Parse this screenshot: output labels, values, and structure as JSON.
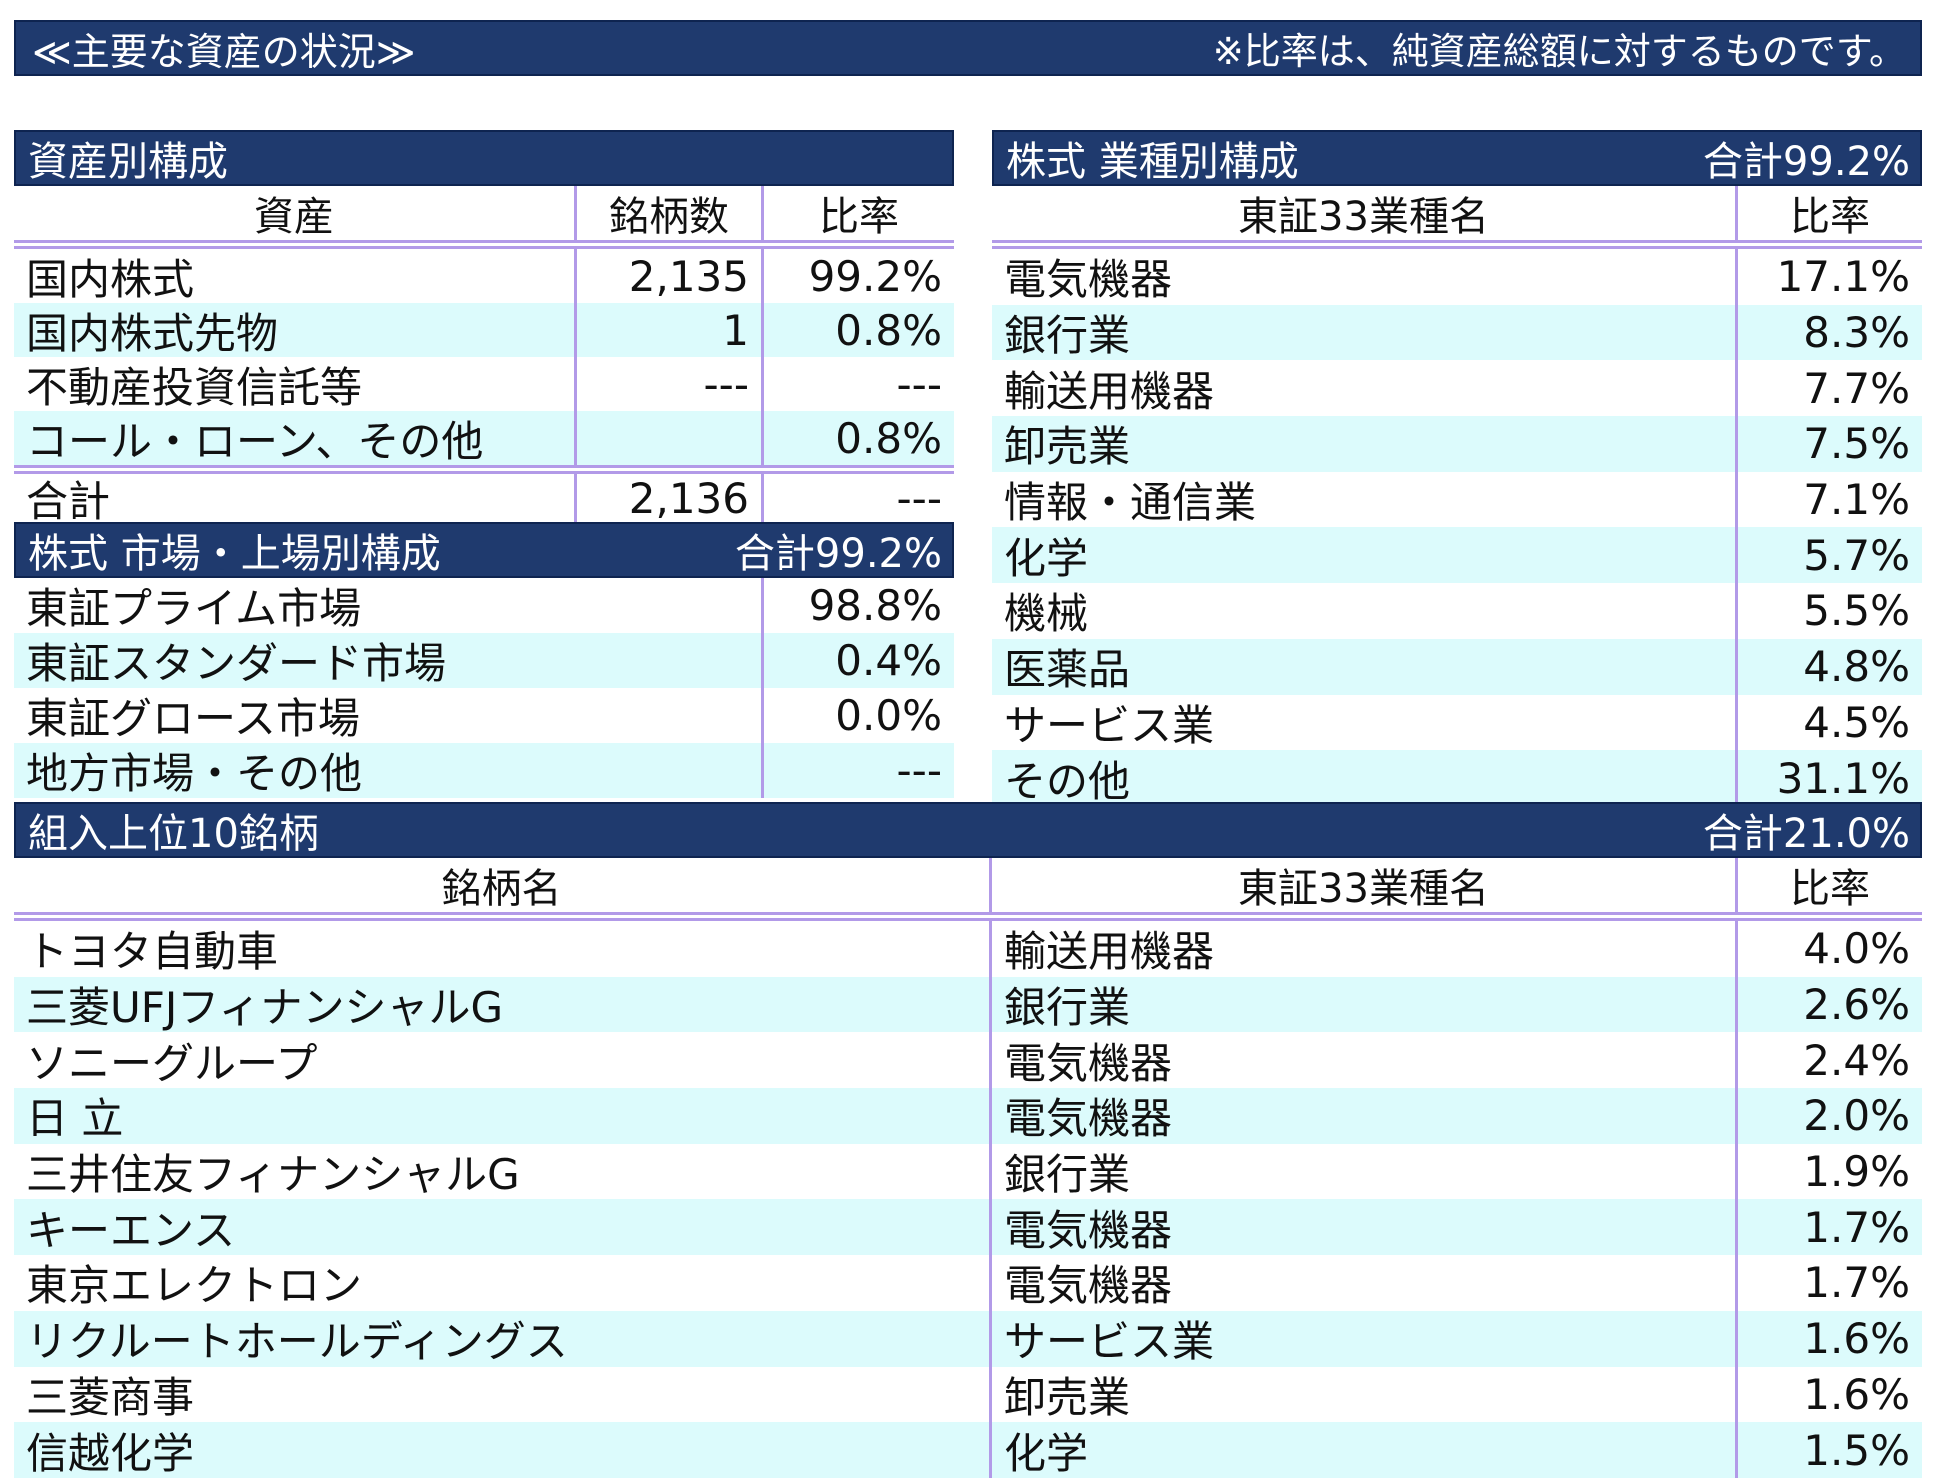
{
  "top": {
    "title": "≪主要な資産の状況≫",
    "note": "※比率は、純資産総額に対するものです。"
  },
  "asset_composition": {
    "title": "資産別構成",
    "headers": {
      "asset": "資産",
      "count": "銘柄数",
      "ratio": "比率"
    },
    "rows": [
      {
        "asset": "国内株式",
        "count": "2,135",
        "ratio": "99.2%"
      },
      {
        "asset": "国内株式先物",
        "count": "1",
        "ratio": "0.8%"
      },
      {
        "asset": "不動産投資信託等",
        "count": "---",
        "ratio": "---"
      },
      {
        "asset": "コール・ローン、その他",
        "count": "",
        "ratio": "0.8%"
      }
    ],
    "total": {
      "label": "合計",
      "count": "2,136",
      "ratio": "---"
    }
  },
  "market_composition": {
    "title": "株式 市場・上場別構成",
    "total": "合計99.2%",
    "rows": [
      {
        "market": "東証プライム市場",
        "ratio": "98.8%"
      },
      {
        "market": "東証スタンダード市場",
        "ratio": "0.4%"
      },
      {
        "market": "東証グロース市場",
        "ratio": "0.0%"
      },
      {
        "market": "地方市場・その他",
        "ratio": "---"
      }
    ]
  },
  "sector_composition": {
    "title": "株式 業種別構成",
    "total": "合計99.2%",
    "headers": {
      "sector": "東証33業種名",
      "ratio": "比率"
    },
    "rows": [
      {
        "sector": "電気機器",
        "ratio": "17.1%"
      },
      {
        "sector": "銀行業",
        "ratio": "8.3%"
      },
      {
        "sector": "輸送用機器",
        "ratio": "7.7%"
      },
      {
        "sector": "卸売業",
        "ratio": "7.5%"
      },
      {
        "sector": "情報・通信業",
        "ratio": "7.1%"
      },
      {
        "sector": "化学",
        "ratio": "5.7%"
      },
      {
        "sector": "機械",
        "ratio": "5.5%"
      },
      {
        "sector": "医薬品",
        "ratio": "4.8%"
      },
      {
        "sector": "サービス業",
        "ratio": "4.5%"
      },
      {
        "sector": "その他",
        "ratio": "31.1%"
      }
    ]
  },
  "top10": {
    "title": "組入上位10銘柄",
    "total": "合計21.0%",
    "headers": {
      "name": "銘柄名",
      "sector": "東証33業種名",
      "ratio": "比率"
    },
    "rows": [
      {
        "name": "トヨタ自動車",
        "sector": "輸送用機器",
        "ratio": "4.0%"
      },
      {
        "name": "三菱UFJフィナンシャルG",
        "sector": "銀行業",
        "ratio": "2.6%"
      },
      {
        "name": "ソニーグループ",
        "sector": "電気機器",
        "ratio": "2.4%"
      },
      {
        "name": "日 立",
        "sector": "電気機器",
        "ratio": "2.0%"
      },
      {
        "name": "三井住友フィナンシャルG",
        "sector": "銀行業",
        "ratio": "1.9%"
      },
      {
        "name": "キーエンス",
        "sector": "電気機器",
        "ratio": "1.7%"
      },
      {
        "name": "東京エレクトロン",
        "sector": "電気機器",
        "ratio": "1.7%"
      },
      {
        "name": "リクルートホールディングス",
        "sector": "サービス業",
        "ratio": "1.6%"
      },
      {
        "name": "三菱商事",
        "sector": "卸売業",
        "ratio": "1.6%"
      },
      {
        "name": "信越化学",
        "sector": "化学",
        "ratio": "1.5%"
      }
    ]
  }
}
